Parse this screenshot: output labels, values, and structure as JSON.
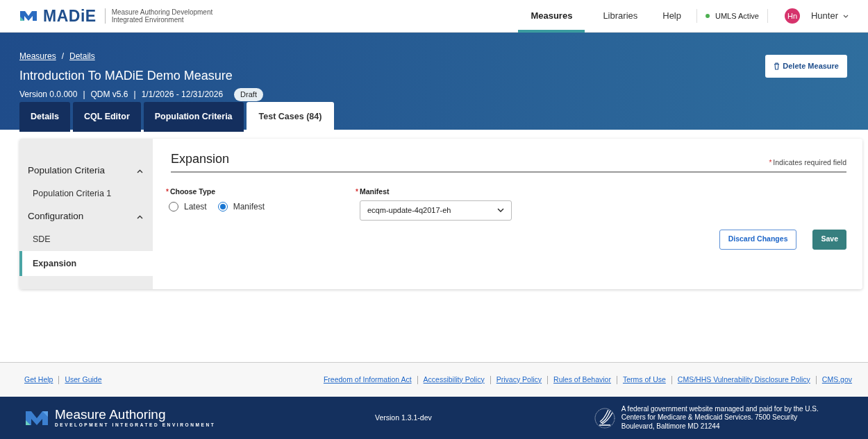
{
  "brand": {
    "name": "MADiE",
    "subtitle_line_1": "Measure Authoring Development",
    "subtitle_line_2": "Integrated Environment"
  },
  "nav": {
    "items": [
      {
        "label": "Measures",
        "selected": true
      },
      {
        "label": "Libraries",
        "selected": false
      },
      {
        "label": "Help",
        "selected": false
      }
    ],
    "status": {
      "label": "UMLS Active",
      "color": "#4caf50"
    },
    "user": {
      "initials": "Hn",
      "name": "Hunter"
    }
  },
  "breadcrumbs": [
    "Measures",
    "Details"
  ],
  "breadcrumb_separator": "/",
  "measure": {
    "title": "Introduction To MADiE Demo Measure",
    "meta": [
      "Version 0.0.000",
      "QDM v5.6",
      "1/1/2026 - 12/31/2026"
    ],
    "separator": "|",
    "status": "Draft"
  },
  "delete_button": "Delete Measure",
  "tabs": [
    {
      "label": "Details",
      "selected": false
    },
    {
      "label": "CQL Editor",
      "selected": false
    },
    {
      "label": "Population Criteria",
      "selected": false
    },
    {
      "label": "Test Cases (84)",
      "selected": true
    }
  ],
  "sidebar": {
    "groups": [
      {
        "label": "Population Criteria",
        "expanded": true,
        "children": [
          {
            "label": "Population Criteria 1",
            "selected": false
          }
        ]
      },
      {
        "label": "Configuration",
        "expanded": true,
        "children": [
          {
            "label": "SDE",
            "selected": false
          },
          {
            "label": "Expansion",
            "selected": true
          }
        ]
      }
    ]
  },
  "form": {
    "heading": "Expansion",
    "required_note": {
      "asterisk": "*",
      "text": "Indicates required field"
    },
    "choose_type": {
      "asterisk": "*",
      "label": "Choose Type",
      "options": [
        {
          "label": "Latest",
          "selected": false
        },
        {
          "label": "Manifest",
          "selected": true
        }
      ]
    },
    "manifest": {
      "asterisk": "*",
      "label": "Manifest",
      "value": "ecqm-update-4q2017-eh"
    },
    "buttons": [
      {
        "label": "Discard Changes",
        "kind": "outline"
      },
      {
        "label": "Save",
        "kind": "primary"
      }
    ]
  },
  "footer": {
    "links_left": [
      "Get Help",
      "User Guide"
    ],
    "links_right": [
      "Freedom of Information Act",
      "Accessibility Policy",
      "Privacy Policy",
      "Rules of Behavior",
      "Terms of Use",
      "CMS/HHS Vulnerability Disclosure Policy",
      "CMS.gov"
    ],
    "logo_title": "Measure Authoring",
    "logo_subtitle": "DEVELOPMENT INTEGRATED ENVIRONMENT",
    "version": "Version 1.3.1-dev",
    "notice_lines": [
      "A federal government website managed and paid for by the U.S.",
      "Centers for Medicare & Medicaid Services. 7500 Security",
      "Boulevard, Baltimore MD 21244"
    ]
  }
}
